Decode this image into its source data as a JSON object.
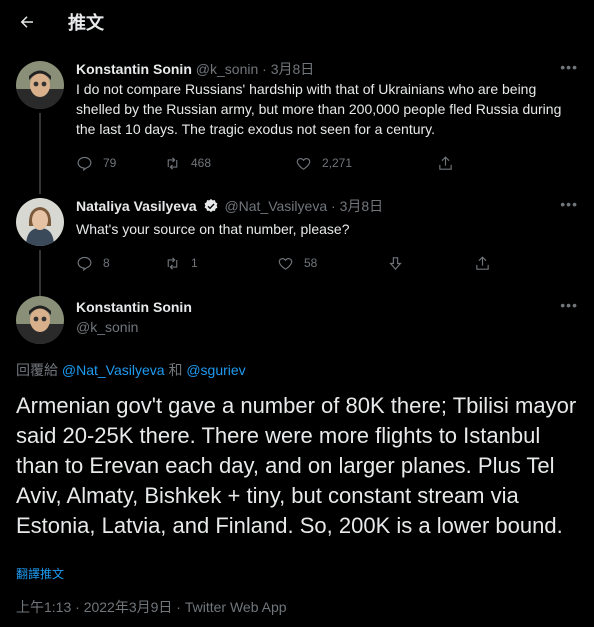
{
  "header": {
    "title": "推文"
  },
  "tweets": [
    {
      "name": "Konstantin Sonin",
      "handle": "@k_sonin",
      "sep": " · ",
      "date": "3月8日",
      "text": "I do not compare Russians' hardship with that of Ukrainians who are being shelled by the Russian army,  but more than 200,000 people fled Russia during the last 10 days. The tragic exodus not seen for a century.",
      "replies": "79",
      "retweets": "468",
      "likes": "2,271"
    },
    {
      "name": "Nataliya Vasilyeva",
      "handle": "@Nat_Vasilyeva",
      "sep": " · ",
      "date": "3月8日",
      "text": "What's your source on that number, please?",
      "replies": "8",
      "retweets": "1",
      "likes": "58"
    }
  ],
  "main": {
    "name": "Konstantin Sonin",
    "handle": "@k_sonin",
    "reply_prefix": "回覆給 ",
    "reply_user1": "@Nat_Vasilyeva",
    "reply_and": " 和 ",
    "reply_user2": "@sguriev",
    "text": "Armenian gov't gave a number of 80K there; Tbilisi mayor said 20-25K there. There were more flights to Istanbul than to Erevan each day, and on larger planes. Plus Tel Aviv, Almaty, Bishkek + tiny, but constant stream via Estonia, Latvia, and Finland. So, 200K is a lower bound.",
    "translate": "翻譯推文",
    "timestamp": "上午1:13 · 2022年3月9日 · Twitter Web App"
  },
  "colors": {
    "background": "#000000",
    "text": "#e7e9ea",
    "muted": "#71767b",
    "link": "#1d9bf0"
  },
  "icons": [
    "back-arrow-icon",
    "more-icon",
    "reply-icon",
    "retweet-icon",
    "like-icon",
    "share-icon",
    "verified-badge-icon"
  ]
}
